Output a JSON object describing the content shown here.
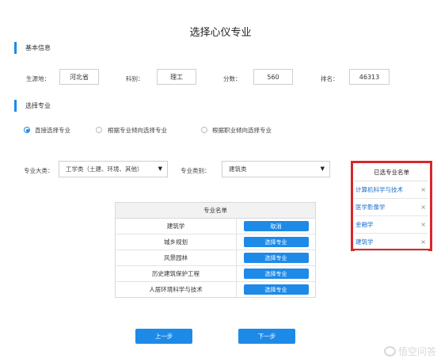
{
  "page_title": "选择心仪专业",
  "section_basic": {
    "title": "基本信息"
  },
  "basic": {
    "origin_label": "生源地：",
    "origin_value": "河北省",
    "subject_label": "科别：",
    "subject_value": "理工",
    "score_label": "分数：",
    "score_value": "560",
    "rank_label": "排名：",
    "rank_value": "46313"
  },
  "section_major": {
    "title": "选择专业"
  },
  "radios": [
    {
      "label": "直接选择专业",
      "selected": true
    },
    {
      "label": "根据专业倾向选择专业",
      "selected": false
    },
    {
      "label": "根据职业倾向选择专业",
      "selected": false
    }
  ],
  "filters": {
    "category_label": "专业大类：",
    "category_value": "工学类（土建、环境、其他）",
    "type_label": "专业类别：",
    "type_value": "建筑类"
  },
  "major_table": {
    "header": "专业名单",
    "rows": [
      {
        "name": "建筑学",
        "action": "取消"
      },
      {
        "name": "城乡规划",
        "action": "选择专业"
      },
      {
        "name": "风景园林",
        "action": "选择专业"
      },
      {
        "name": "历史建筑保护工程",
        "action": "选择专业"
      },
      {
        "name": "人居环境科学与技术",
        "action": "选择专业"
      }
    ]
  },
  "selected_panel": {
    "title": "已选专业名单",
    "items": [
      {
        "name": "计算机科学与技术",
        "remove": "×"
      },
      {
        "name": "医学影像学",
        "remove": "×"
      },
      {
        "name": "金融学",
        "remove": "×"
      },
      {
        "name": "建筑学",
        "remove": "×"
      }
    ]
  },
  "nav": {
    "prev": "上一步",
    "next": "下一步"
  },
  "watermark": {
    "text": "悟空问答",
    "icon": "chat-bubble-icon"
  },
  "colors": {
    "accent": "#1e8ae8",
    "highlight_border": "#d9262a"
  }
}
